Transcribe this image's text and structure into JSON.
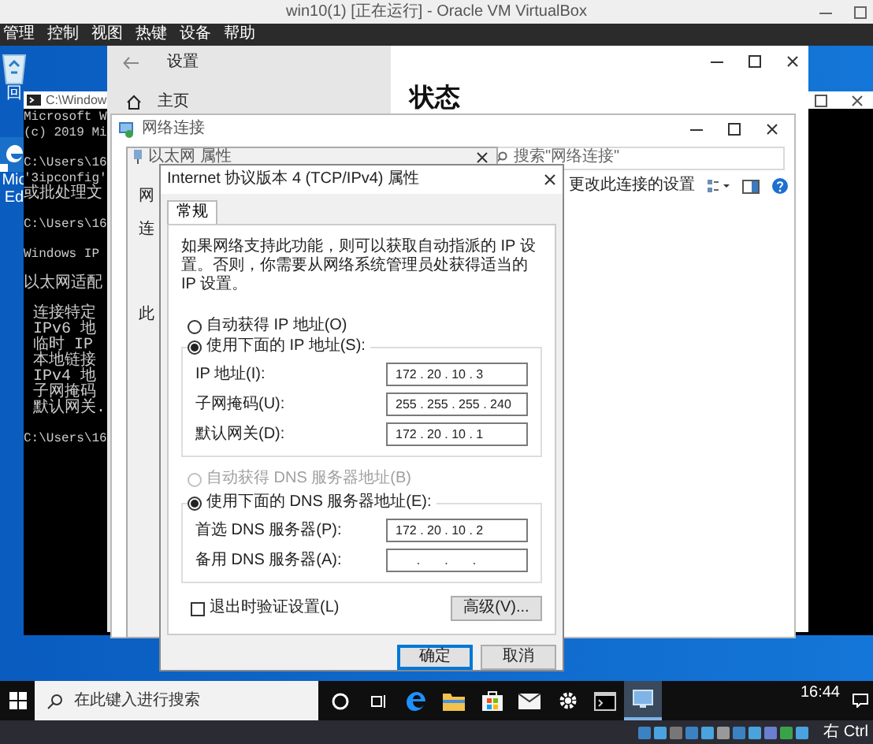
{
  "window": {
    "title": "win10(1) [正在运行] - Oracle VM VirtualBox"
  },
  "menu": [
    "管理",
    "控制",
    "视图",
    "热键",
    "设备",
    "帮助"
  ],
  "desktop_icons": [
    {
      "kind": "recycle",
      "label": "回"
    },
    {
      "kind": "edge",
      "label": "Mic",
      "label_2": "Ed"
    }
  ],
  "cmd": {
    "title": "C:\\Window",
    "lines": [
      {
        "text": "Microsoft W",
        "indent": false,
        "space_before": false
      },
      {
        "text": "(c) 2019 Mi",
        "indent": false,
        "space_before": false
      },
      {
        "text": "C:\\Users\\16",
        "indent": false,
        "space_before": true
      },
      {
        "text": "'3ipconfig'",
        "indent": false,
        "space_before": false
      },
      {
        "text": "或批处理文",
        "indent": false,
        "space_before": false
      },
      {
        "text": "C:\\Users\\16",
        "indent": false,
        "space_before": true
      },
      {
        "text": "Windows IP",
        "indent": false,
        "space_before": true
      },
      {
        "text": "以太网适配",
        "indent": false,
        "space_before": true
      },
      {
        "text": "连接特定",
        "indent": true,
        "space_before": true
      },
      {
        "text": "IPv6 地",
        "indent": true,
        "space_before": false
      },
      {
        "text": "临时 IP",
        "indent": true,
        "space_before": false
      },
      {
        "text": "本地链接",
        "indent": true,
        "space_before": false
      },
      {
        "text": "IPv4 地",
        "indent": true,
        "space_before": false
      },
      {
        "text": "子网掩码",
        "indent": true,
        "space_before": false
      },
      {
        "text": "默认网关.",
        "indent": true,
        "space_before": false
      },
      {
        "text": "C:\\Users\\16",
        "indent": false,
        "space_before": true
      }
    ]
  },
  "settings": {
    "title": "设置",
    "nav_item": "主页",
    "heading": "状态"
  },
  "network": {
    "title": "网络连接",
    "search": {
      "placeholder": "搜索\"网络连接\""
    },
    "command": "更改此连接的设置"
  },
  "ethernet": {
    "title": "以太网 属性",
    "edge_texts": [
      "网",
      "连",
      "此"
    ]
  },
  "ipv4": {
    "title": "Internet 协议版本 4 (TCP/IPv4) 属性",
    "tabs": [
      {
        "label": "常规",
        "selected": true
      }
    ],
    "description": "如果网络支持此功能，则可以获取自动指派的 IP 设置。否则，你需要从网络系统管理员处获得适当的 IP 设置。",
    "ip_options": [
      {
        "label": "自动获得 IP 地址(O)",
        "selected": false,
        "disabled": false
      },
      {
        "label": "使用下面的 IP 地址(S):",
        "selected": true,
        "disabled": false
      }
    ],
    "ip_fields": [
      {
        "label": "IP 地址(I):",
        "value": "172 . 20 . 10 . 3"
      },
      {
        "label": "子网掩码(U):",
        "value": "255 . 255 . 255 . 240"
      },
      {
        "label": "默认网关(D):",
        "value": "172 . 20 . 10 . 1"
      }
    ],
    "dns_options": [
      {
        "label": "自动获得 DNS 服务器地址(B)",
        "selected": false,
        "disabled": true
      },
      {
        "label": "使用下面的 DNS 服务器地址(E):",
        "selected": true,
        "disabled": false
      }
    ],
    "dns_fields": [
      {
        "label": "首选 DNS 服务器(P):",
        "value": "172 . 20 . 10 . 2"
      },
      {
        "label": "备用 DNS 服务器(A):",
        "value": "      .       .       ."
      }
    ],
    "validate": {
      "label": "退出时验证设置(L)",
      "checked": false
    },
    "advanced_button": "高级(V)...",
    "buttons": [
      {
        "label": "确定",
        "default": true
      },
      {
        "label": "取消",
        "default": false
      }
    ]
  },
  "taskbar": {
    "search": {
      "placeholder": "在此键入进行搜索"
    },
    "apps": [
      {
        "kind": "cortana",
        "active": false
      },
      {
        "kind": "taskview",
        "active": false
      },
      {
        "kind": "edge",
        "active": false
      },
      {
        "kind": "folder",
        "active": false
      },
      {
        "kind": "store",
        "active": false
      },
      {
        "kind": "mail",
        "active": false
      },
      {
        "kind": "settings",
        "active": false
      },
      {
        "kind": "terminal",
        "active": false
      },
      {
        "kind": "network",
        "active": true
      }
    ],
    "time": "16:44"
  },
  "status_bar": {
    "host_key": "右 Ctrl"
  }
}
